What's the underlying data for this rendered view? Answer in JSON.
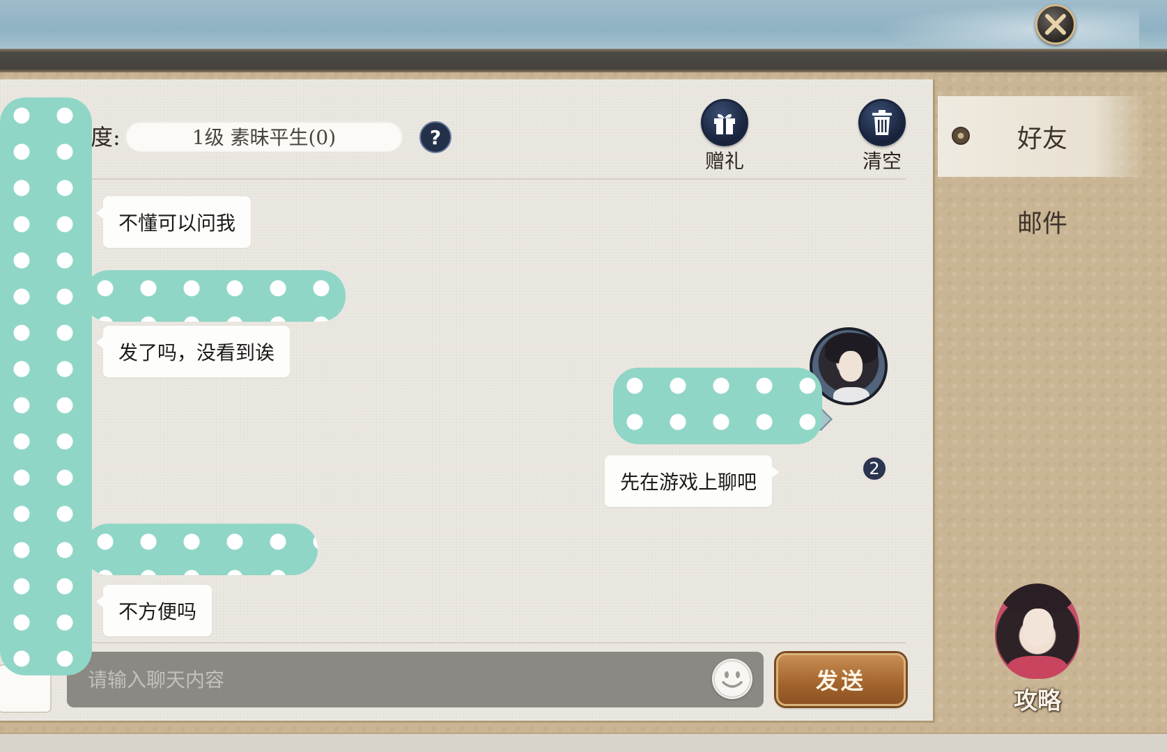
{
  "window": {
    "close_icon": "close-x-icon"
  },
  "header": {
    "friendship_label": "友度:",
    "friendship_value": "1级 素昧平生(0)",
    "help_label": "?",
    "gift_label": "赠礼",
    "clear_label": "清空"
  },
  "messages": [
    {
      "side": "left",
      "text": "不懂可以问我"
    },
    {
      "side": "left",
      "text": "发了吗，没看到诶"
    },
    {
      "side": "right",
      "text": "先在游戏上聊吧",
      "badge": "2"
    },
    {
      "side": "left",
      "text": "不方便吗"
    }
  ],
  "input": {
    "placeholder": "请输入聊天内容",
    "send_label": "发送"
  },
  "sidebar": {
    "tabs": [
      {
        "label": "好友",
        "active": true
      },
      {
        "label": "邮件",
        "active": false
      }
    ],
    "guide_label": "攻略"
  },
  "colors": {
    "send_button": "#a2632c",
    "icon_button": "#1f2c47",
    "panel_bg": "#ebe8e1",
    "frame_bg": "#c9b594"
  }
}
